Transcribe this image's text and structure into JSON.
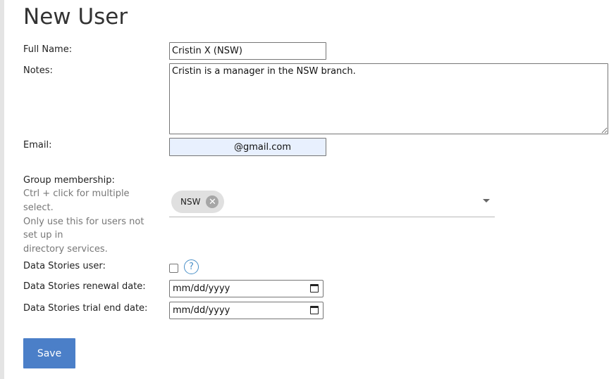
{
  "page": {
    "title": "New User"
  },
  "form": {
    "full_name": {
      "label": "Full Name:",
      "value": "Cristin X (NSW)"
    },
    "notes": {
      "label": "Notes:",
      "value": "Cristin is a manager in the NSW branch."
    },
    "email": {
      "label": "Email:",
      "value": "@gmail.com"
    },
    "group_membership": {
      "label": "Group membership:",
      "hint_1": "Ctrl + click for multiple",
      "hint_2": "select.",
      "hint_3": "Only use this for users not",
      "hint_4": "set up in",
      "hint_5": "directory services.",
      "selected": [
        "NSW"
      ],
      "remove_glyph": "✕"
    },
    "data_stories_user": {
      "label": "Data Stories user:",
      "checked": false,
      "help_glyph": "?"
    },
    "renewal_date": {
      "label": "Data Stories renewal date:",
      "placeholder": "mm/dd/yyyy"
    },
    "trial_end_date": {
      "label": "Data Stories trial end date:",
      "placeholder": "mm/dd/yyyy"
    }
  },
  "actions": {
    "save_label": "Save"
  },
  "colors": {
    "save_button": "#4b7fc8",
    "help_icon": "#4a90c8",
    "email_autofill_bg": "#e8f0fe",
    "chip_bg": "#e0e0e0"
  },
  "icons": {
    "help": "question-circle-icon",
    "chip_remove": "close-circle-icon",
    "dropdown": "caret-down-icon",
    "date": "calendar-icon"
  }
}
